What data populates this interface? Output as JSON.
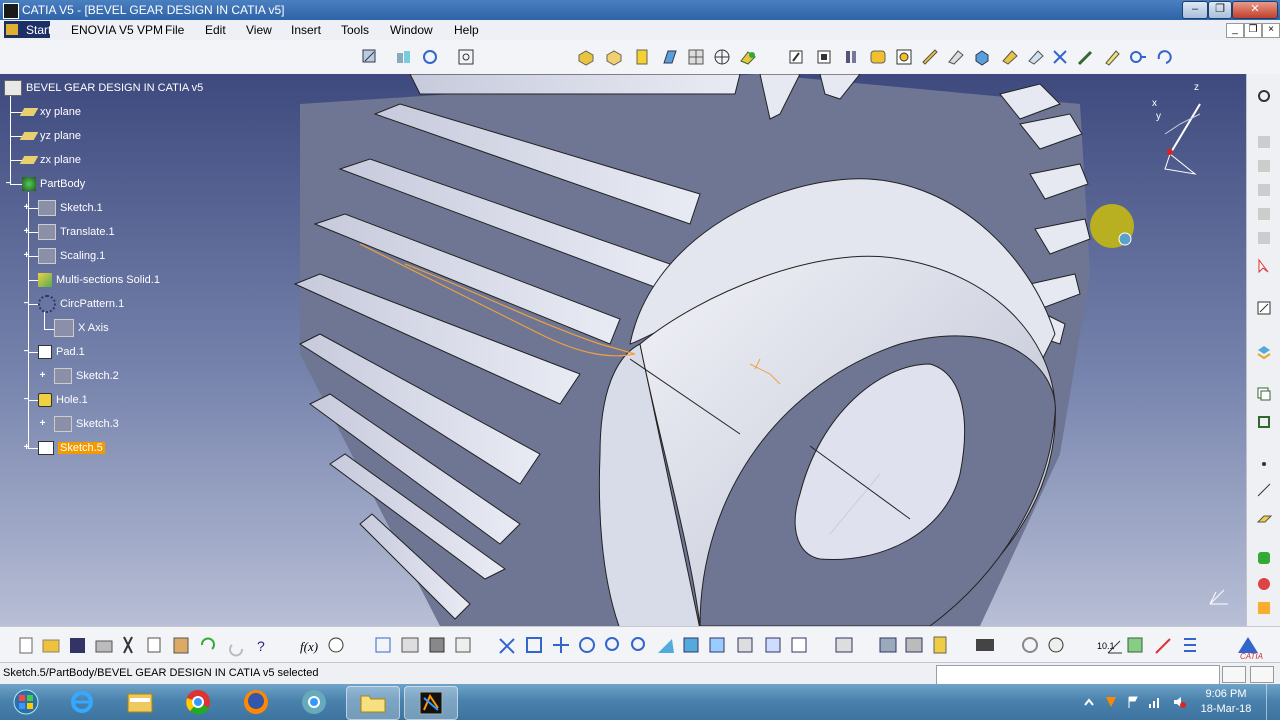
{
  "window": {
    "title": "CATIA V5 - [BEVEL GEAR DESIGN IN CATIA v5]",
    "min_glyph": "–",
    "max_glyph": "❐",
    "close_glyph": "✕"
  },
  "menu": {
    "start": "Start",
    "items": [
      "ENOVIA V5 VPM",
      "File",
      "Edit",
      "View",
      "Insert",
      "Tools",
      "Window",
      "Help"
    ]
  },
  "mdi": {
    "min": "_",
    "restore": "❐",
    "close": "×"
  },
  "tree": {
    "root": "BEVEL GEAR DESIGN IN CATIA v5",
    "nodes": [
      "xy plane",
      "yz plane",
      "zx plane",
      "PartBody",
      "Sketch.1",
      "Translate.1",
      "Scaling.1",
      "Multi-sections Solid.1",
      "CircPattern.1",
      "X Axis",
      "Pad.1",
      "Sketch.2",
      "Hole.1",
      "Sketch.3",
      "Sketch.5"
    ],
    "selected": "Sketch.5"
  },
  "compass": {
    "x": "x",
    "y": "y",
    "z": "z"
  },
  "status": {
    "text": "Sketch.5/PartBody/BEVEL GEAR DESIGN IN CATIA v5 selected",
    "command_value": ""
  },
  "taskbar": {
    "apps": [
      "windows-explorer",
      "internet-explorer",
      "file-explorer",
      "chrome",
      "firefox",
      "chrome-alt",
      "folder",
      "catia"
    ],
    "time": "9:06 PM",
    "date": "18-Mar-18"
  },
  "colors": {
    "selection": "#f39a00",
    "titlebar": "#2e63a8",
    "viewport_top": "#3e4a7e",
    "gear_face": "#d4d8e6",
    "sketch_curve": "#f0a040"
  },
  "icons": {
    "top_toolbar": [
      "sketch-icon",
      "plane-icon",
      "axis-icon",
      "snap-icon",
      "pad-icon",
      "pocket-icon",
      "shaft-icon",
      "groove-icon",
      "hole-icon",
      "rib-icon",
      "slot-icon",
      "stiffener-icon",
      "loft-icon",
      "fillet-icon",
      "chamfer-icon",
      "draft-icon",
      "shell-icon",
      "thickness-icon",
      "thread-icon",
      "remove-icon",
      "mirror-icon",
      "pattern-icon",
      "scale-icon",
      "split-icon",
      "measure-icon",
      "constraint-icon",
      "rotate-icon"
    ],
    "bottom_toolbar": [
      "new-icon",
      "open-icon",
      "save-icon",
      "print-icon",
      "cut-icon",
      "copy-icon",
      "paste-icon",
      "undo-icon",
      "redo-icon",
      "whats-this-icon",
      "formula-icon",
      "knowledge-icon",
      "design-table-icon",
      "law-icon",
      "parameter-icon",
      "catalog-icon",
      "fly-icon",
      "fit-all-icon",
      "pan-icon",
      "rotate-view-icon",
      "zoom-in-icon",
      "zoom-out-icon",
      "normal-view-icon",
      "iso-view-icon",
      "view-mode-icon",
      "hide-show-icon",
      "swap-icon",
      "render-icon",
      "measure-between-icon",
      "mass-icon",
      "capture-icon",
      "analysis-icon",
      "constraint-toggle-icon",
      "scale-tool-icon",
      "axis-tool-icon",
      "spec-icon",
      "draft-analysis-icon"
    ]
  }
}
